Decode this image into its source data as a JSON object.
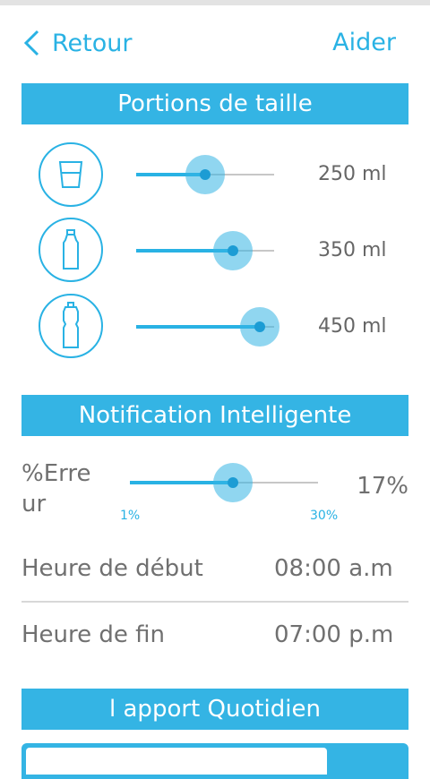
{
  "header": {
    "back_label": "Retour",
    "help_label": "Aider"
  },
  "portions": {
    "title": "Portions de taille",
    "items": [
      {
        "icon": "glass-icon",
        "value_label": "250 ml",
        "slider_fraction": 0.5
      },
      {
        "icon": "bottle-icon",
        "value_label": "350 ml",
        "slider_fraction": 0.7
      },
      {
        "icon": "sport-bottle-icon",
        "value_label": "450 ml",
        "slider_fraction": 0.9
      }
    ]
  },
  "notification": {
    "title": "Notification Intelligente",
    "error_label_line1": "%Erre",
    "error_label_line2": "ur",
    "error_value": "17%",
    "min_label": "1%",
    "max_label": "30%",
    "slider_value": 17,
    "start_label": "Heure de début",
    "start_value": "08:00 a.m",
    "end_label": "Heure de fin",
    "end_value": "07:00 p.m"
  },
  "daily": {
    "title": "l apport Quotidien"
  },
  "colors": {
    "accent": "#34b4e4",
    "text_gray": "#707070"
  }
}
